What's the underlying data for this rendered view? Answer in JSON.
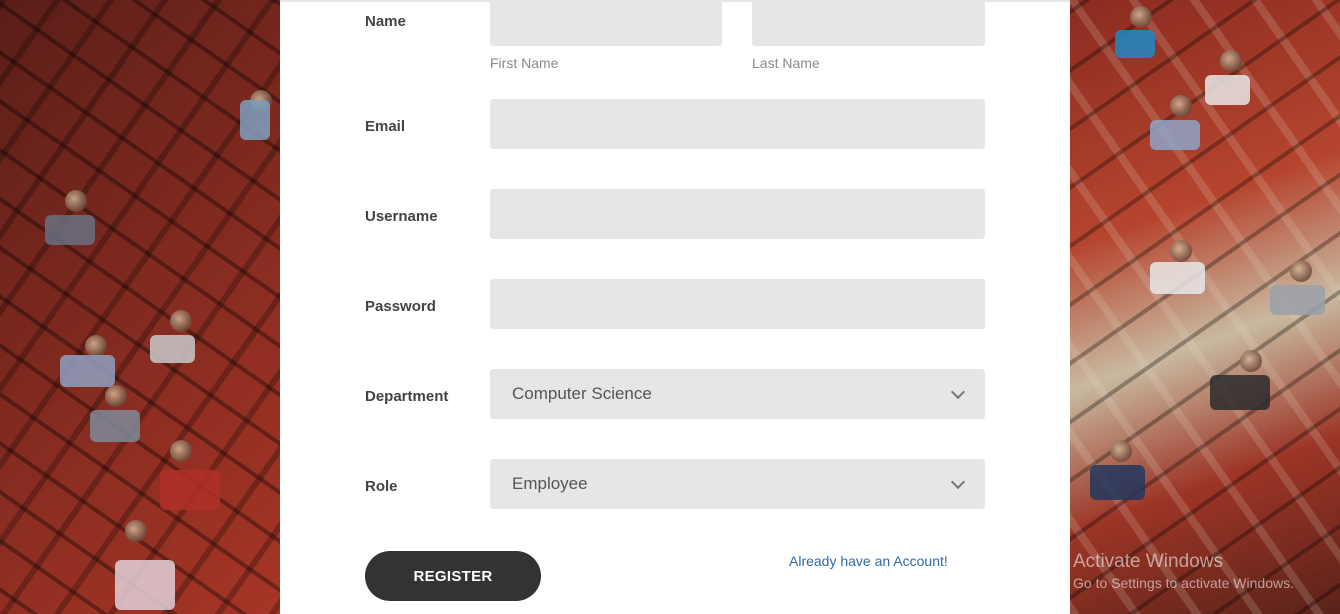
{
  "form": {
    "name": {
      "label": "Name",
      "first": {
        "value": "",
        "hint": "First Name"
      },
      "last": {
        "value": "",
        "hint": "Last Name"
      }
    },
    "email": {
      "label": "Email",
      "value": ""
    },
    "username": {
      "label": "Username",
      "value": ""
    },
    "password": {
      "label": "Password",
      "value": ""
    },
    "department": {
      "label": "Department",
      "selected": "Computer Science"
    },
    "role": {
      "label": "Role",
      "selected": "Employee"
    },
    "register_label": "REGISTER",
    "login_link": "Already have an Account!"
  },
  "watermark": {
    "line1": "Activate Windows",
    "line2": "Go to Settings to activate Windows."
  },
  "colors": {
    "panel_bg": "#ffffff",
    "field_bg": "#e6e6e6",
    "button_bg": "#333333",
    "link": "#2f6aa3"
  }
}
